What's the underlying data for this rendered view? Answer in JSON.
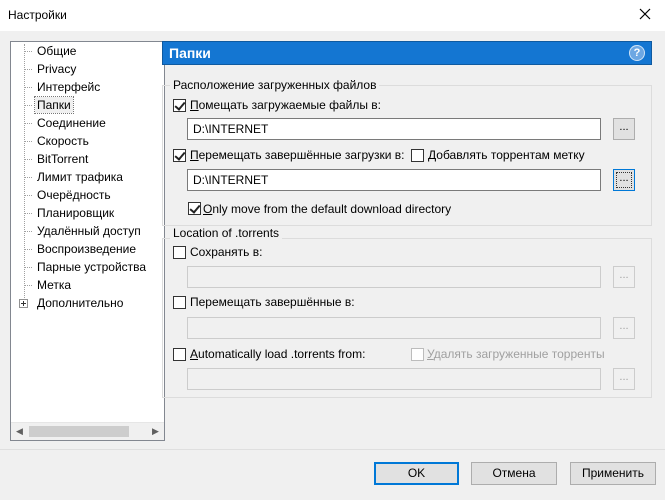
{
  "window": {
    "title": "Настройки"
  },
  "tree": {
    "items": [
      {
        "label": "Общие"
      },
      {
        "label": "Privacy"
      },
      {
        "label": "Интерфейс"
      },
      {
        "label": "Папки",
        "selected": true
      },
      {
        "label": "Соединение"
      },
      {
        "label": "Скорость"
      },
      {
        "label": "BitTorrent"
      },
      {
        "label": "Лимит трафика"
      },
      {
        "label": "Очерёдность"
      },
      {
        "label": "Планировщик"
      },
      {
        "label": "Удалённый доступ"
      },
      {
        "label": "Воспроизведение"
      },
      {
        "label": "Парные устройства"
      },
      {
        "label": "Метка"
      },
      {
        "label": "Дополнительно",
        "expandable": true
      }
    ]
  },
  "header": {
    "title": "Папки",
    "help_glyph": "?"
  },
  "downloads": {
    "group_label": "Расположение загруженных файлов",
    "put_new": {
      "label_u": "П",
      "label_rest": "омещать загружаемые файлы в:",
      "checked": true,
      "path": "D:\\INTERNET",
      "browse": "..."
    },
    "move_completed": {
      "label_u": "П",
      "label_rest": "еремещать завершённые загрузки в:",
      "checked": true,
      "path": "D:\\INTERNET",
      "browse": "..."
    },
    "append_label": {
      "label_u": "Д",
      "label_rest": "обавлять торрентам метку",
      "checked": false
    },
    "only_move": {
      "label_u": "O",
      "label_rest": "nly move from the default download directory",
      "checked": true
    }
  },
  "torrents": {
    "group_label": "Location of .torrents",
    "store": {
      "label": "Сохранять в:",
      "checked": false,
      "path": "",
      "browse": "..."
    },
    "move_completed": {
      "label": "Перемещать завершённые в:",
      "checked": false,
      "path": "",
      "browse": "..."
    },
    "auto_load": {
      "label_u": "A",
      "label_rest": "utomatically load .torrents from:",
      "checked": false,
      "path": "",
      "browse": "..."
    },
    "delete_loaded": {
      "label_u": "У",
      "label_rest": "далять загруженные торренты",
      "checked": false
    }
  },
  "buttons": {
    "ok": "OK",
    "cancel": "Отмена",
    "apply": "Применить"
  },
  "colors": {
    "header_bg": "#1476d2",
    "focus": "#0078d7"
  }
}
